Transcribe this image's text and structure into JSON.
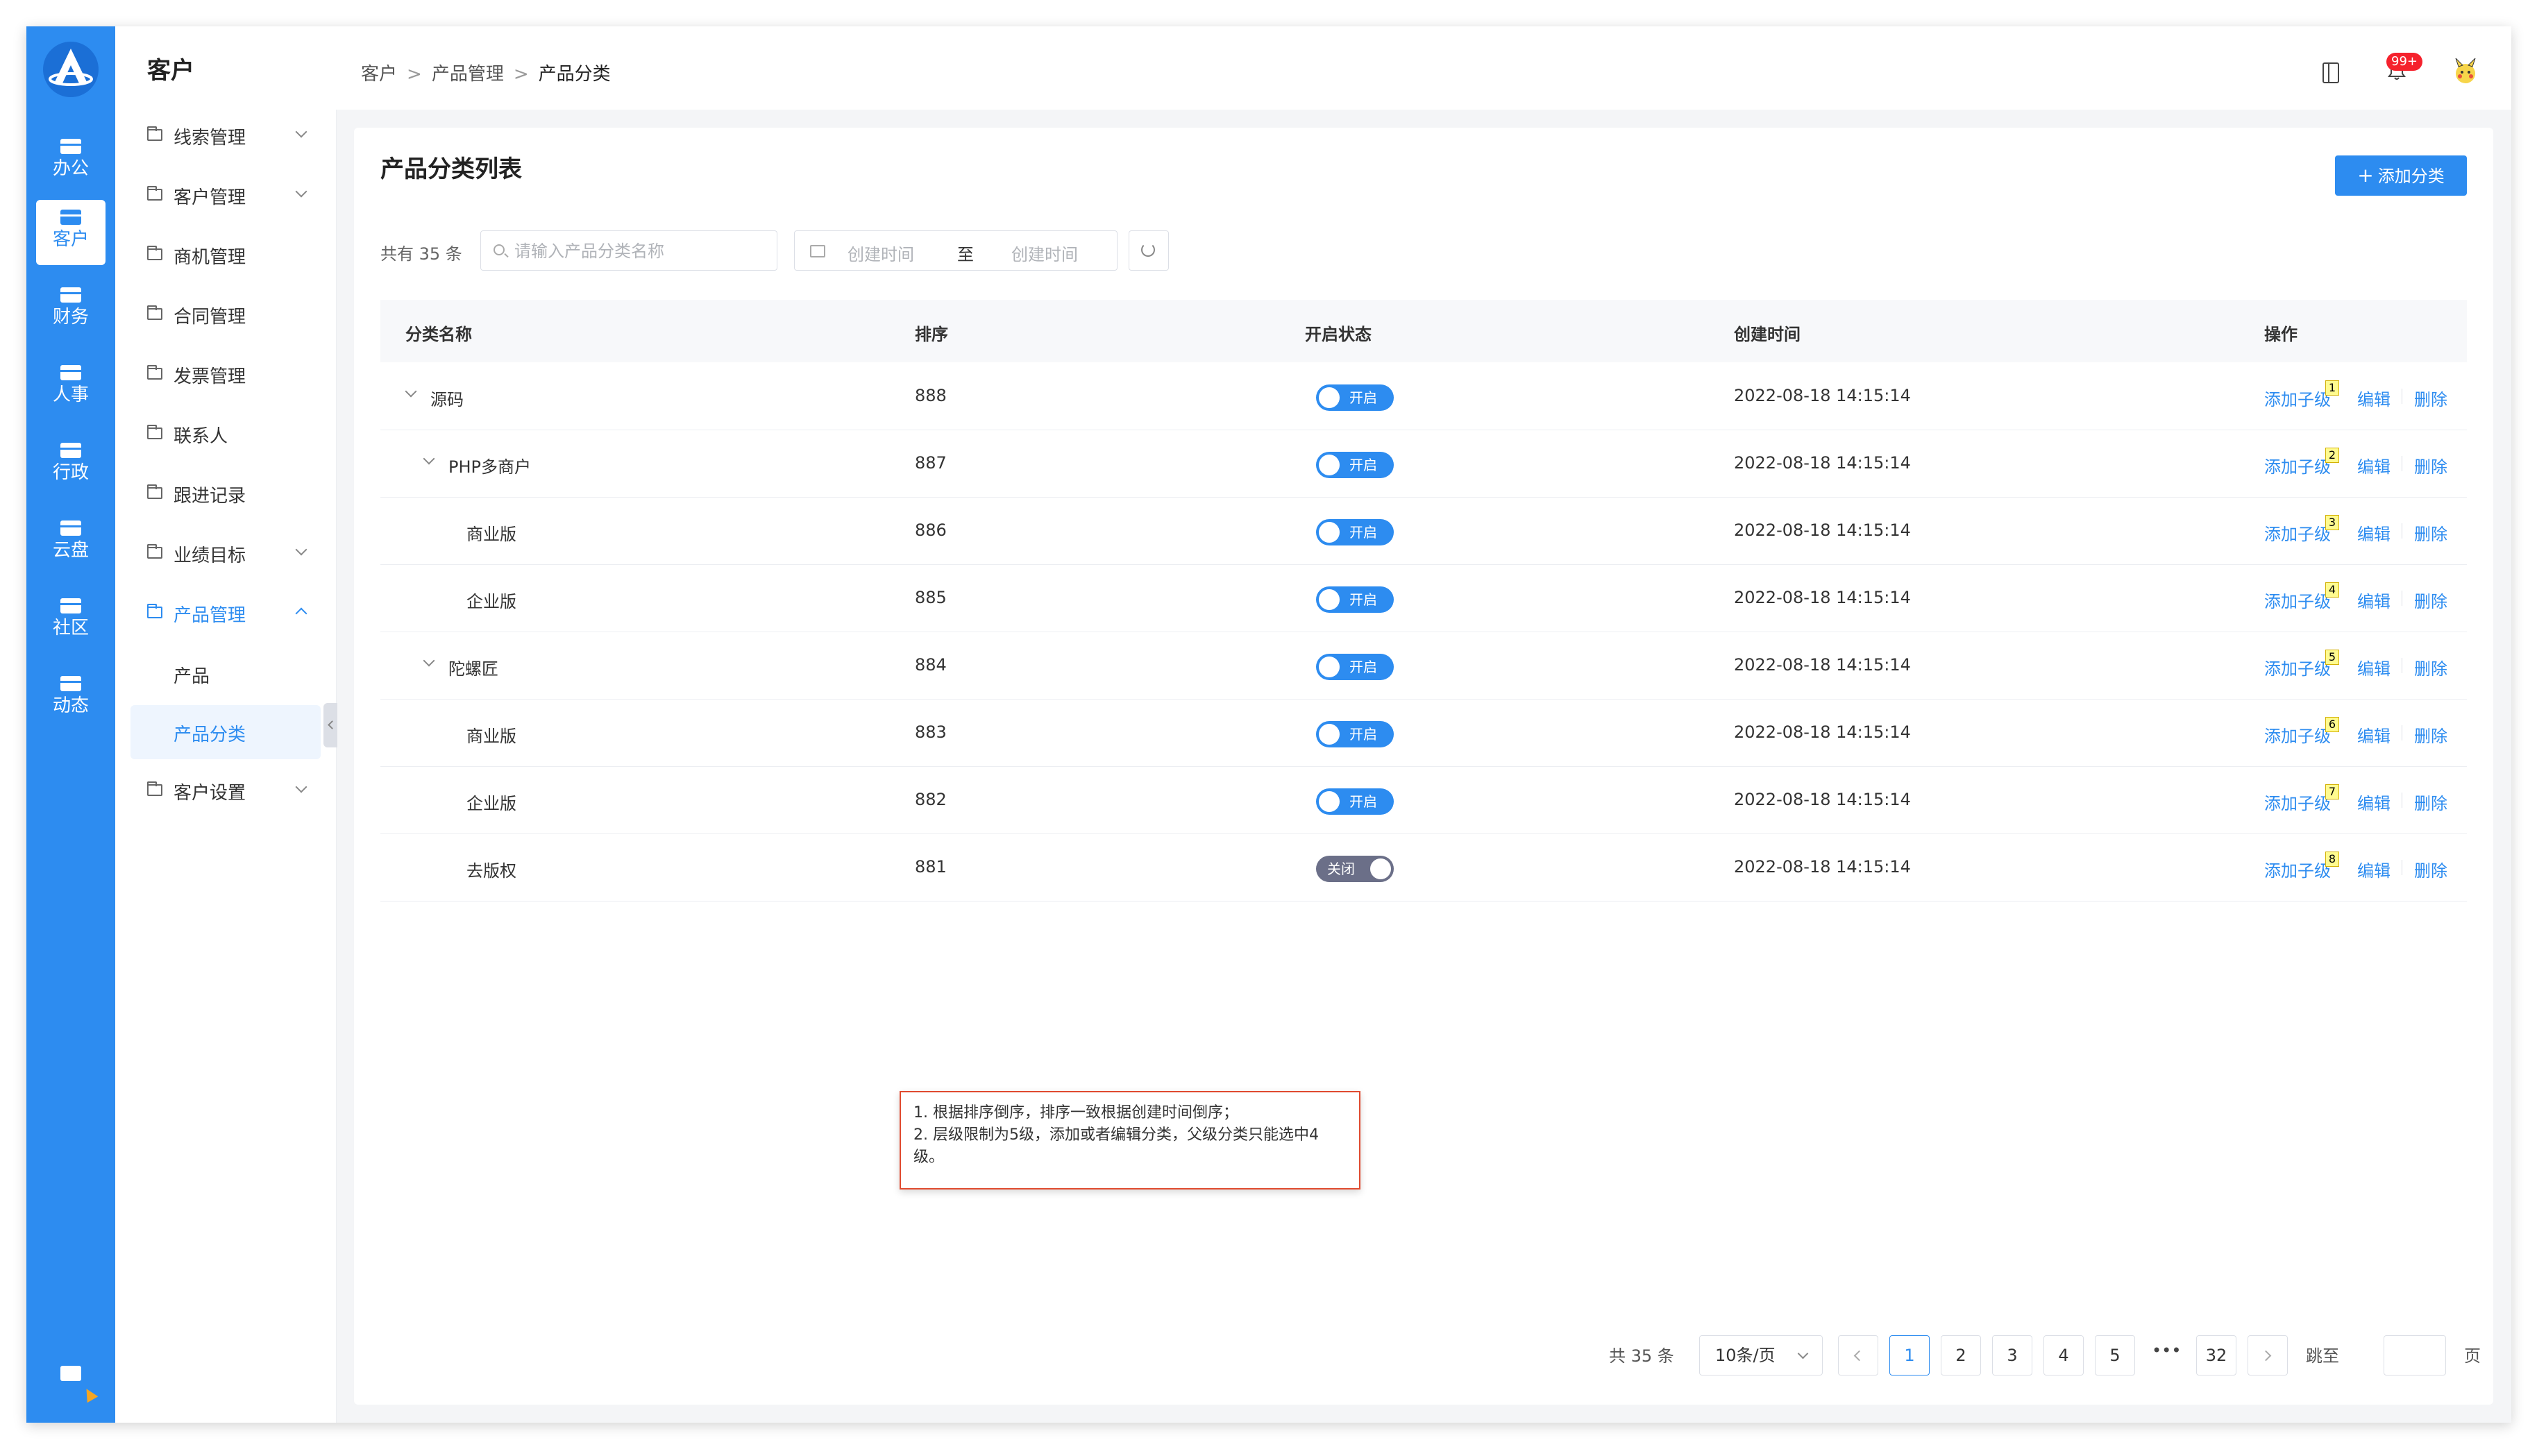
{
  "app": {
    "rail_items": [
      {
        "label": "办公",
        "active": false
      },
      {
        "label": "客户",
        "active": true
      },
      {
        "label": "财务",
        "active": false
      },
      {
        "label": "人事",
        "active": false
      },
      {
        "label": "行政",
        "active": false
      },
      {
        "label": "云盘",
        "active": false
      },
      {
        "label": "社区",
        "active": false
      },
      {
        "label": "动态",
        "active": false
      }
    ]
  },
  "sidebar": {
    "title": "客户",
    "items": [
      {
        "label": "线索管理"
      },
      {
        "label": "客户管理"
      },
      {
        "label": "商机管理"
      },
      {
        "label": "合同管理"
      },
      {
        "label": "发票管理"
      },
      {
        "label": "联系人"
      },
      {
        "label": "跟进记录"
      },
      {
        "label": "业绩目标"
      },
      {
        "label": "产品管理"
      },
      {
        "label": "客户设置"
      }
    ],
    "sub_items": [
      {
        "label": "产品"
      },
      {
        "label": "产品分类"
      }
    ]
  },
  "header": {
    "breadcrumb": [
      "客户",
      "产品管理",
      "产品分类"
    ],
    "notification_badge": "99+"
  },
  "page": {
    "title": "产品分类列表",
    "add_button": "添加分类",
    "total_text": "共有 35 条",
    "search_placeholder": "请输入产品分类名称",
    "date_start_placeholder": "创建时间",
    "date_to": "至",
    "date_end_placeholder": "创建时间"
  },
  "table": {
    "columns": [
      "分类名称",
      "排序",
      "开启状态",
      "创建时间",
      "操作"
    ],
    "rows": [
      {
        "name": "源码",
        "sort": "888",
        "status": "开启",
        "created": "2022-08-18 14:15:14",
        "note": "1"
      },
      {
        "name": "PHP多商户",
        "sort": "887",
        "status": "开启",
        "created": "2022-08-18 14:15:14",
        "note": "2"
      },
      {
        "name": "商业版",
        "sort": "886",
        "status": "开启",
        "created": "2022-08-18 14:15:14",
        "note": "3"
      },
      {
        "name": "企业版",
        "sort": "885",
        "status": "开启",
        "created": "2022-08-18 14:15:14",
        "note": "4"
      },
      {
        "name": "陀螺匠",
        "sort": "884",
        "status": "开启",
        "created": "2022-08-18 14:15:14",
        "note": "5"
      },
      {
        "name": "商业版",
        "sort": "883",
        "status": "开启",
        "created": "2022-08-18 14:15:14",
        "note": "6"
      },
      {
        "name": "企业版",
        "sort": "882",
        "status": "开启",
        "created": "2022-08-18 14:15:14",
        "note": "7"
      },
      {
        "name": "去版权",
        "sort": "881",
        "status": "关闭",
        "created": "2022-08-18 14:15:14",
        "note": "8"
      }
    ],
    "actions": {
      "add_child": "添加子级",
      "edit": "编辑",
      "delete": "删除"
    }
  },
  "annotation": {
    "line1": "1. 根据排序倒序，排序一致根据创建时间倒序；",
    "line2": "2. 层级限制为5级，添加或者编辑分类，父级分类只能选中4级。"
  },
  "pagination": {
    "total": "共 35 条",
    "page_size": "10条/页",
    "pages": [
      "1",
      "2",
      "3",
      "4",
      "5"
    ],
    "ellipsis": "•••",
    "last_page": "32",
    "jump_label": "跳至",
    "page_suffix": "页"
  },
  "colors": {
    "primary": "#2d8cf0",
    "switch_off": "#6b6f88",
    "annotation_border": "#e04a2f"
  }
}
